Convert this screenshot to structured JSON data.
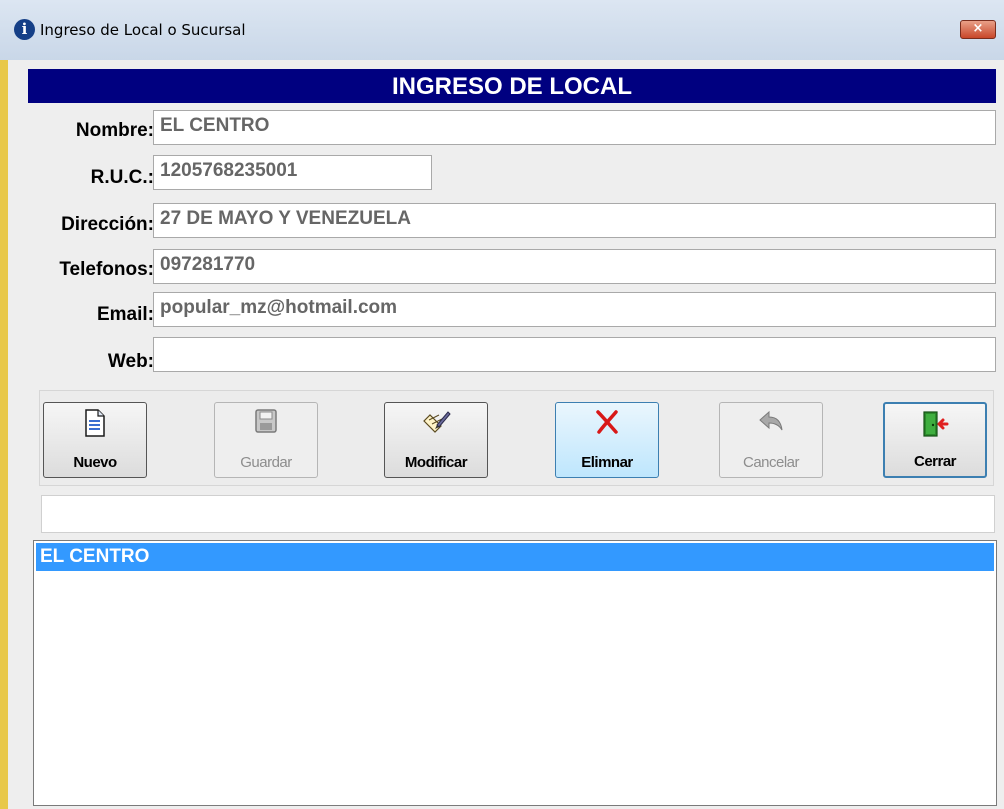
{
  "window": {
    "title": "Ingreso de Local o Sucursal",
    "close_glyph": "×"
  },
  "header": {
    "title": "INGRESO DE LOCAL"
  },
  "form": {
    "nombre": {
      "label": "Nombre:",
      "value": "EL CENTRO"
    },
    "ruc": {
      "label": "R.U.C.:",
      "value": "1205768235001"
    },
    "direccion": {
      "label": "Dirección:",
      "value": "27 DE MAYO Y VENEZUELA"
    },
    "telefonos": {
      "label": "Telefonos:",
      "value": "097281770"
    },
    "email": {
      "label": "Email:",
      "value": "popular_mz@hotmail.com"
    },
    "web": {
      "label": "Web:",
      "value": ""
    }
  },
  "toolbar": {
    "nuevo": "Nuevo",
    "guardar": "Guardar",
    "modificar": "Modificar",
    "eliminar": "Elimnar",
    "cancelar": "Cancelar",
    "cerrar": "Cerrar"
  },
  "status": {
    "value": ""
  },
  "list": {
    "items": [
      "EL CENTRO"
    ],
    "selected_index": 0
  },
  "colors": {
    "header_bg": "#000080",
    "selection_bg": "#3399ff",
    "window_border": "#e8c84a"
  },
  "icons": {
    "title": "info-icon",
    "nuevo": "new-document-icon",
    "guardar": "floppy-disk-icon",
    "modificar": "edit-pencil-icon",
    "eliminar": "red-x-icon",
    "cancelar": "undo-arrow-icon",
    "cerrar": "exit-door-icon"
  }
}
